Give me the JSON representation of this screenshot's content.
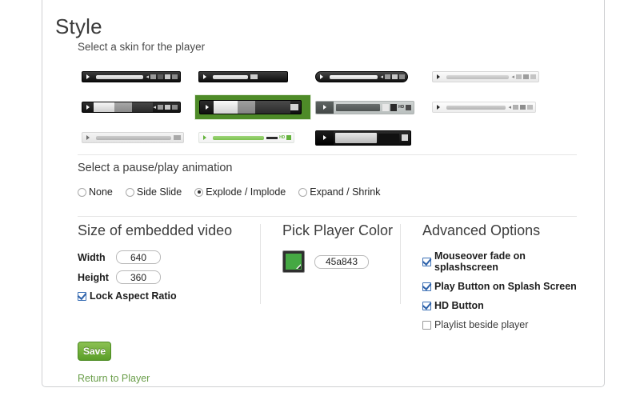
{
  "page": {
    "title": "Style",
    "skin_prompt": "Select a skin for the player",
    "animation_prompt": "Select a pause/play animation"
  },
  "colors": {
    "brand_green": "#45a843",
    "selected_skin_highlight": "#4e8b28",
    "save_button_green": "#5a9e28",
    "link_green": "#6a9e4a",
    "panel_border": "#cfd0d2",
    "divider": "#e6e6e6"
  },
  "skins": [
    {
      "id": "skin-1",
      "label": "Dark Slim Full Controls",
      "selected": false
    },
    {
      "id": "skin-2",
      "label": "Dark HD Only",
      "selected": false
    },
    {
      "id": "skin-3",
      "label": "Dark Rounded Pill",
      "selected": false
    },
    {
      "id": "skin-4",
      "label": "Light Gray Slim",
      "selected": false
    },
    {
      "id": "skin-5",
      "label": "Dark Segmented",
      "selected": false
    },
    {
      "id": "skin-6",
      "label": "Dark Segmented Large",
      "selected": true
    },
    {
      "id": "skin-7",
      "label": "Gray Big Play Button",
      "selected": false
    },
    {
      "id": "skin-8",
      "label": "Light With Dark Controls",
      "selected": false
    },
    {
      "id": "skin-9",
      "label": "Light Minimal",
      "selected": false
    },
    {
      "id": "skin-10",
      "label": "Green Light",
      "selected": false
    },
    {
      "id": "skin-11",
      "label": "Chrome Large",
      "selected": false
    }
  ],
  "animations": [
    {
      "label": "None",
      "checked": false
    },
    {
      "label": "Side Slide",
      "checked": false
    },
    {
      "label": "Explode / Implode",
      "checked": true
    },
    {
      "label": "Expand / Shrink",
      "checked": false
    }
  ],
  "size_section": {
    "title": "Size of embedded video",
    "width_label": "Width",
    "width_value": "640",
    "height_label": "Height",
    "height_value": "360",
    "lock_label": "Lock Aspect Ratio",
    "lock_checked": true
  },
  "color_section": {
    "title": "Pick Player Color",
    "hex_value": "45a843",
    "hex_placeholder": "45a843",
    "swatch_color": "#45a843"
  },
  "advanced_section": {
    "title": "Advanced Options",
    "options": [
      {
        "label": "Mouseover fade on splashscreen",
        "checked": true
      },
      {
        "label": "Play Button on Splash Screen",
        "checked": true
      },
      {
        "label": "HD Button",
        "checked": true
      },
      {
        "label": "Playlist beside player",
        "checked": false
      }
    ]
  },
  "actions": {
    "save_label": "Save",
    "return_label": "Return to Player"
  },
  "icons": {
    "play": "play-icon",
    "volume": "volume-icon",
    "hd": "hd-icon",
    "fullscreen": "fullscreen-icon",
    "eyedropper": "eyedropper-icon"
  },
  "mini_labels": {
    "hd": "HD"
  }
}
